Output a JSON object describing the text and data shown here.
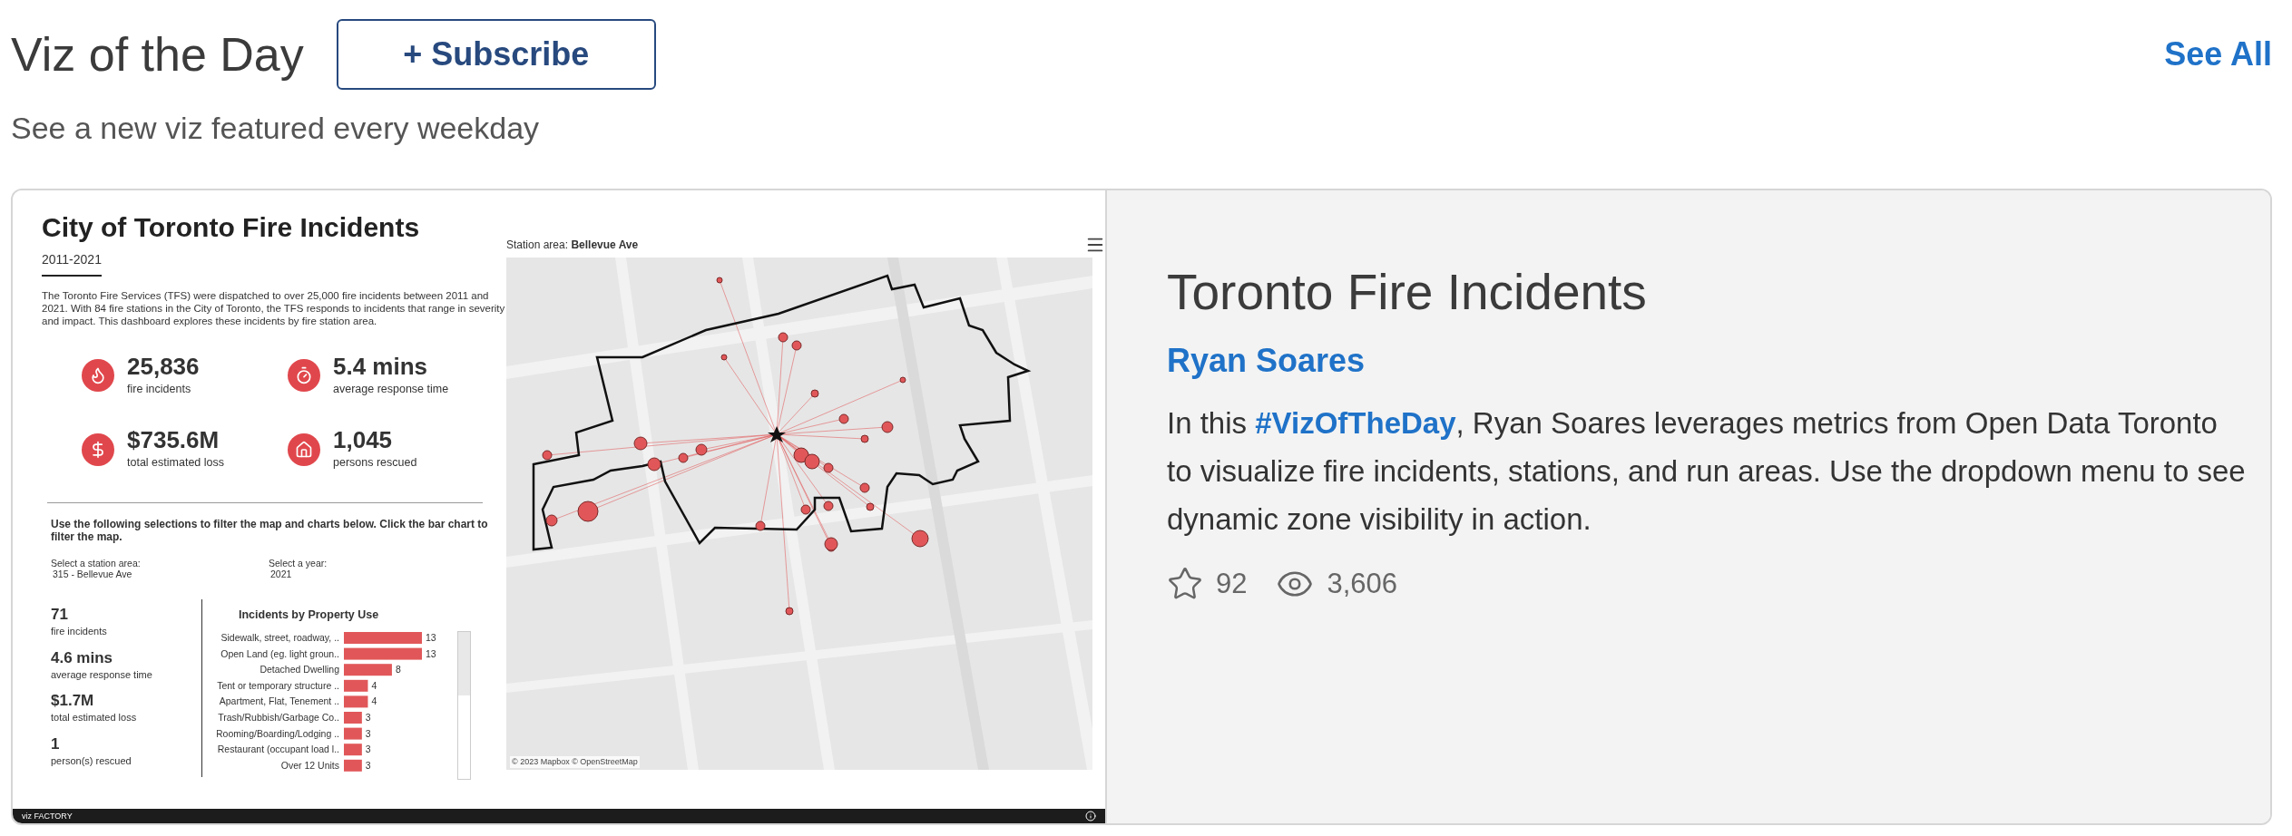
{
  "header": {
    "title": "Viz of the Day",
    "subscribe_button": "+ Subscribe",
    "see_all_link": "See All",
    "subtitle": "See a new viz featured every weekday"
  },
  "featured": {
    "dashboard": {
      "title": "City of Toronto Fire Incidents",
      "years": "2011-2021",
      "intro": "The Toronto Fire Services (TFS) were dispatched to over 25,000 fire incidents between 2011 and 2021. With 84 fire stations in the City of Toronto, the TFS responds to incidents that range in severity and impact. This dashboard explores these incidents by fire station area.",
      "kpis": [
        {
          "kind": "fire",
          "value": "25,836",
          "label": "fire incidents"
        },
        {
          "kind": "timer",
          "value": "5.4 mins",
          "label": "average response time"
        },
        {
          "kind": "dollar",
          "value": "$735.6M",
          "label": "total estimated loss"
        },
        {
          "kind": "house",
          "value": "1,045",
          "label": "persons rescued"
        }
      ],
      "instruction": "Use the following selections to filter the map and charts below. Click the bar chart to filter the map.",
      "filters": [
        {
          "label": "Select a station area:",
          "value": "315 - Bellevue Ave"
        },
        {
          "label": "Select a year:",
          "value": "2021"
        }
      ],
      "station_stats": [
        {
          "value": "71",
          "label": "fire incidents"
        },
        {
          "value": "4.6 mins",
          "label": "average response time"
        },
        {
          "value": "$1.7M",
          "label": "total estimated loss"
        },
        {
          "value": "1",
          "label": "person(s) rescued"
        }
      ],
      "chart_title": "Incidents by Property Use",
      "chart_data": {
        "type": "bar",
        "orientation": "horizontal",
        "data_labels": true,
        "categories": [
          "Sidewalk, street, roadway, ..",
          "Open Land (eg. light groun..",
          "Detached Dwelling",
          "Tent or temporary structure ..",
          "Apartment, Flat, Tenement ..",
          "Trash/Rubbish/Garbage Co..",
          "Rooming/Boarding/Lodging ..",
          "Restaurant (occupant load l..",
          "Over 12 Units"
        ],
        "values": [
          13,
          13,
          8,
          4,
          4,
          3,
          3,
          3,
          3
        ]
      },
      "map": {
        "title": "Station area: **Bellevue Ave**",
        "attribution": "© 2023 Mapbox © OpenStreetMap"
      },
      "footer_brand": "viz FACTORY"
    },
    "title": "Toronto Fire Incidents",
    "author": "Ryan Soares",
    "description": {
      "before": "In this ",
      "link": "#VizOfTheDay",
      "after": ", Ryan Soares leverages metrics from Open Data Toronto to visualize fire incidents, stations, and run areas. Use the dropdown menu to see dynamic zone visibility in action."
    },
    "favorites": "92",
    "views": "3,606"
  }
}
